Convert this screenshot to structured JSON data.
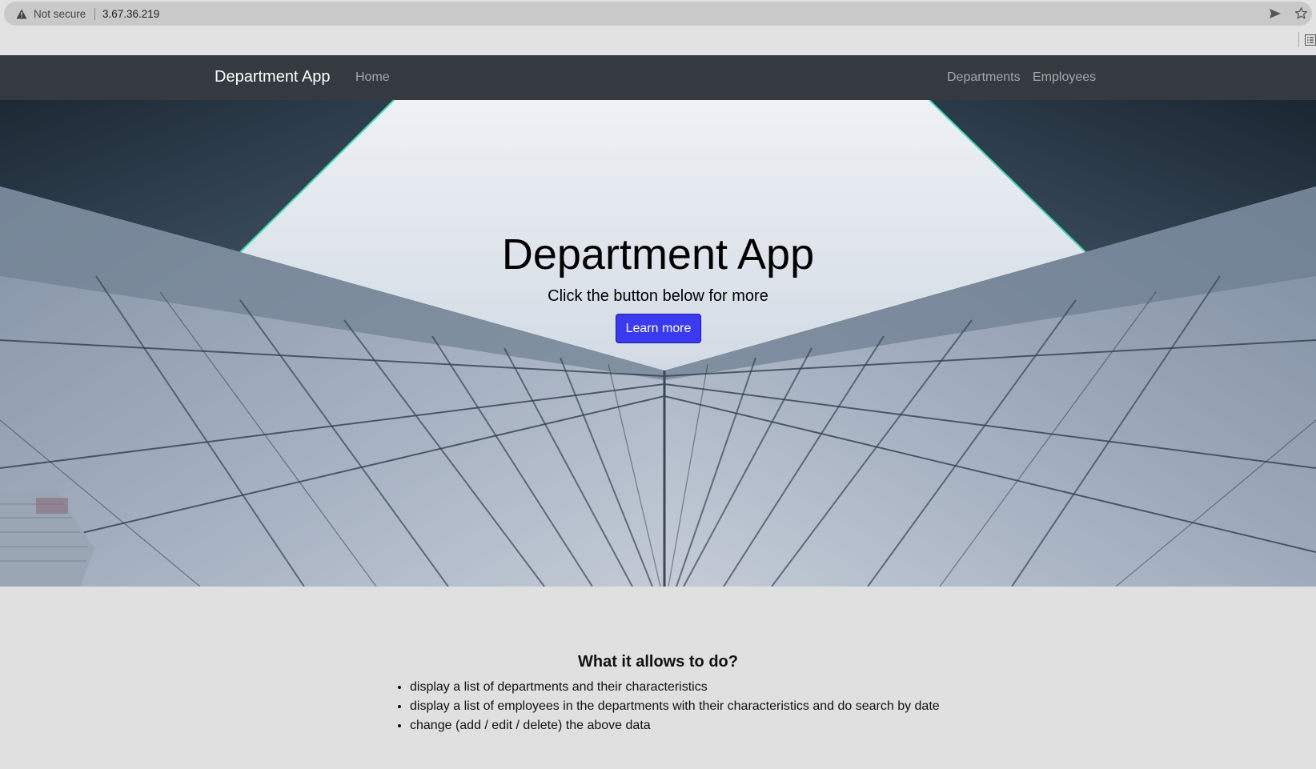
{
  "browser": {
    "security_label": "Not secure",
    "url": "3.67.36.219"
  },
  "navbar": {
    "brand": "Department App",
    "home": "Home",
    "departments": "Departments",
    "employees": "Employees"
  },
  "hero": {
    "title": "Department App",
    "subtitle": "Click the button below for more",
    "button_label": "Learn more"
  },
  "info": {
    "title": "What it allows to do?",
    "items": [
      "display a list of departments and their characteristics",
      "display a list of employees in the departments with their characteristics and do search by date",
      "change (add / edit / delete) the above data"
    ]
  },
  "colors": {
    "navbar_bg": "#343a40",
    "button_bg": "#3a3af0",
    "page_bg": "#e0e0e0"
  }
}
